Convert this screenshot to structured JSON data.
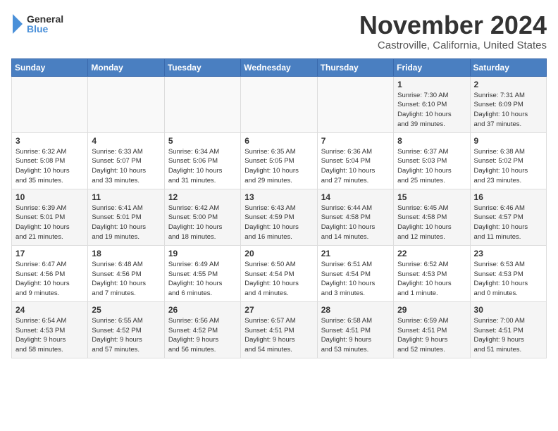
{
  "header": {
    "logo_general": "General",
    "logo_blue": "Blue",
    "month_title": "November 2024",
    "location": "Castroville, California, United States"
  },
  "weekdays": [
    "Sunday",
    "Monday",
    "Tuesday",
    "Wednesday",
    "Thursday",
    "Friday",
    "Saturday"
  ],
  "weeks": [
    [
      {
        "day": "",
        "info": ""
      },
      {
        "day": "",
        "info": ""
      },
      {
        "day": "",
        "info": ""
      },
      {
        "day": "",
        "info": ""
      },
      {
        "day": "",
        "info": ""
      },
      {
        "day": "1",
        "info": "Sunrise: 7:30 AM\nSunset: 6:10 PM\nDaylight: 10 hours\nand 39 minutes."
      },
      {
        "day": "2",
        "info": "Sunrise: 7:31 AM\nSunset: 6:09 PM\nDaylight: 10 hours\nand 37 minutes."
      }
    ],
    [
      {
        "day": "3",
        "info": "Sunrise: 6:32 AM\nSunset: 5:08 PM\nDaylight: 10 hours\nand 35 minutes."
      },
      {
        "day": "4",
        "info": "Sunrise: 6:33 AM\nSunset: 5:07 PM\nDaylight: 10 hours\nand 33 minutes."
      },
      {
        "day": "5",
        "info": "Sunrise: 6:34 AM\nSunset: 5:06 PM\nDaylight: 10 hours\nand 31 minutes."
      },
      {
        "day": "6",
        "info": "Sunrise: 6:35 AM\nSunset: 5:05 PM\nDaylight: 10 hours\nand 29 minutes."
      },
      {
        "day": "7",
        "info": "Sunrise: 6:36 AM\nSunset: 5:04 PM\nDaylight: 10 hours\nand 27 minutes."
      },
      {
        "day": "8",
        "info": "Sunrise: 6:37 AM\nSunset: 5:03 PM\nDaylight: 10 hours\nand 25 minutes."
      },
      {
        "day": "9",
        "info": "Sunrise: 6:38 AM\nSunset: 5:02 PM\nDaylight: 10 hours\nand 23 minutes."
      }
    ],
    [
      {
        "day": "10",
        "info": "Sunrise: 6:39 AM\nSunset: 5:01 PM\nDaylight: 10 hours\nand 21 minutes."
      },
      {
        "day": "11",
        "info": "Sunrise: 6:41 AM\nSunset: 5:01 PM\nDaylight: 10 hours\nand 19 minutes."
      },
      {
        "day": "12",
        "info": "Sunrise: 6:42 AM\nSunset: 5:00 PM\nDaylight: 10 hours\nand 18 minutes."
      },
      {
        "day": "13",
        "info": "Sunrise: 6:43 AM\nSunset: 4:59 PM\nDaylight: 10 hours\nand 16 minutes."
      },
      {
        "day": "14",
        "info": "Sunrise: 6:44 AM\nSunset: 4:58 PM\nDaylight: 10 hours\nand 14 minutes."
      },
      {
        "day": "15",
        "info": "Sunrise: 6:45 AM\nSunset: 4:58 PM\nDaylight: 10 hours\nand 12 minutes."
      },
      {
        "day": "16",
        "info": "Sunrise: 6:46 AM\nSunset: 4:57 PM\nDaylight: 10 hours\nand 11 minutes."
      }
    ],
    [
      {
        "day": "17",
        "info": "Sunrise: 6:47 AM\nSunset: 4:56 PM\nDaylight: 10 hours\nand 9 minutes."
      },
      {
        "day": "18",
        "info": "Sunrise: 6:48 AM\nSunset: 4:56 PM\nDaylight: 10 hours\nand 7 minutes."
      },
      {
        "day": "19",
        "info": "Sunrise: 6:49 AM\nSunset: 4:55 PM\nDaylight: 10 hours\nand 6 minutes."
      },
      {
        "day": "20",
        "info": "Sunrise: 6:50 AM\nSunset: 4:54 PM\nDaylight: 10 hours\nand 4 minutes."
      },
      {
        "day": "21",
        "info": "Sunrise: 6:51 AM\nSunset: 4:54 PM\nDaylight: 10 hours\nand 3 minutes."
      },
      {
        "day": "22",
        "info": "Sunrise: 6:52 AM\nSunset: 4:53 PM\nDaylight: 10 hours\nand 1 minute."
      },
      {
        "day": "23",
        "info": "Sunrise: 6:53 AM\nSunset: 4:53 PM\nDaylight: 10 hours\nand 0 minutes."
      }
    ],
    [
      {
        "day": "24",
        "info": "Sunrise: 6:54 AM\nSunset: 4:53 PM\nDaylight: 9 hours\nand 58 minutes."
      },
      {
        "day": "25",
        "info": "Sunrise: 6:55 AM\nSunset: 4:52 PM\nDaylight: 9 hours\nand 57 minutes."
      },
      {
        "day": "26",
        "info": "Sunrise: 6:56 AM\nSunset: 4:52 PM\nDaylight: 9 hours\nand 56 minutes."
      },
      {
        "day": "27",
        "info": "Sunrise: 6:57 AM\nSunset: 4:51 PM\nDaylight: 9 hours\nand 54 minutes."
      },
      {
        "day": "28",
        "info": "Sunrise: 6:58 AM\nSunset: 4:51 PM\nDaylight: 9 hours\nand 53 minutes."
      },
      {
        "day": "29",
        "info": "Sunrise: 6:59 AM\nSunset: 4:51 PM\nDaylight: 9 hours\nand 52 minutes."
      },
      {
        "day": "30",
        "info": "Sunrise: 7:00 AM\nSunset: 4:51 PM\nDaylight: 9 hours\nand 51 minutes."
      }
    ]
  ]
}
